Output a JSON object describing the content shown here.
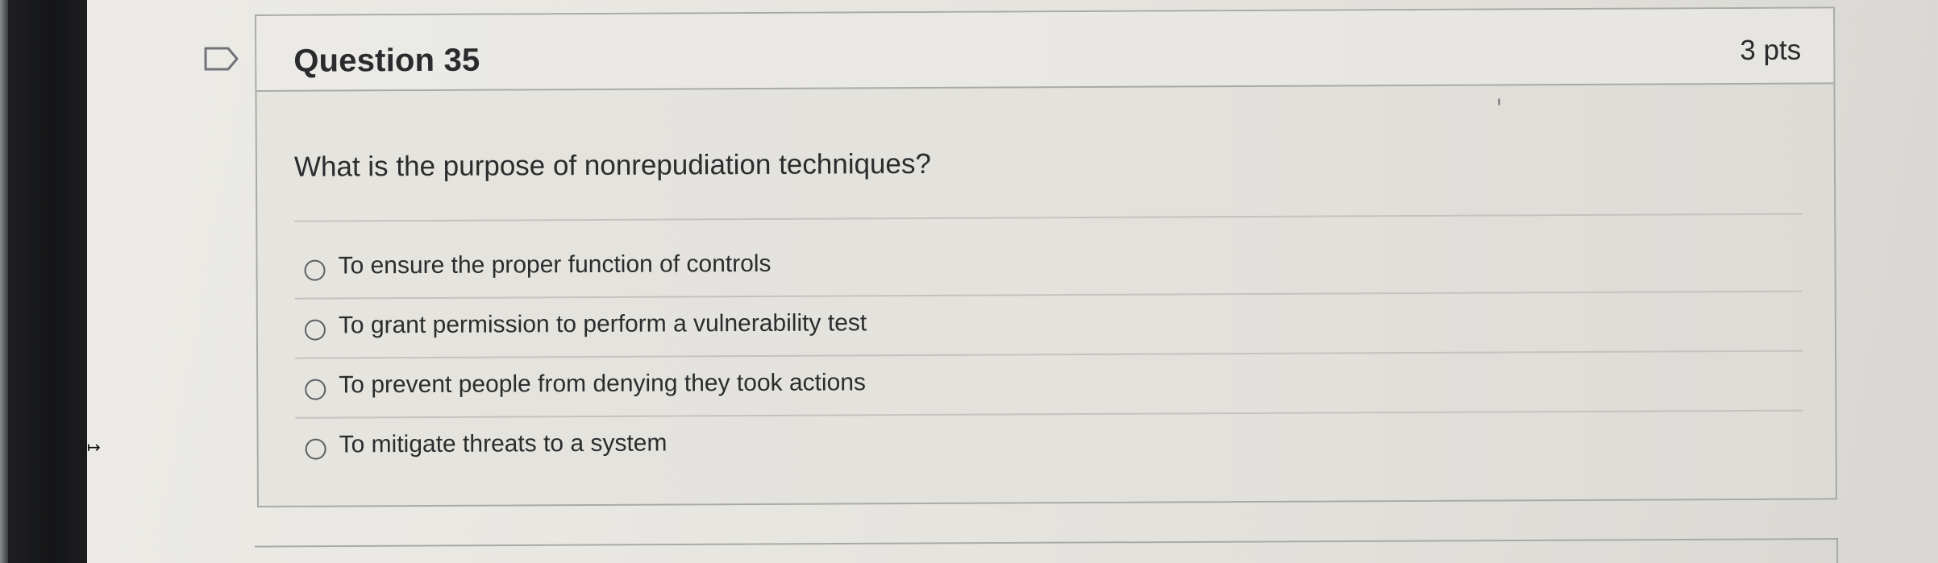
{
  "question": {
    "title": "Question 35",
    "points": "3 pts",
    "prompt": "What is the purpose of nonrepudiation techniques?",
    "answers": [
      {
        "label": "To ensure the proper function of controls",
        "selected": false
      },
      {
        "label": "To grant permission to perform a vulnerability test",
        "selected": false
      },
      {
        "label": "To prevent people from denying they took actions",
        "selected": false
      },
      {
        "label": "To mitigate threats to a system",
        "selected": false
      }
    ]
  },
  "icons": {
    "flag": "flag-question-icon",
    "radio": "radio-button-icon",
    "cursor": "arrow-cursor-icon"
  },
  "colors": {
    "text": "#2b2c2e",
    "border": "#a9aaa8",
    "radio_border": "#5d5f63"
  }
}
